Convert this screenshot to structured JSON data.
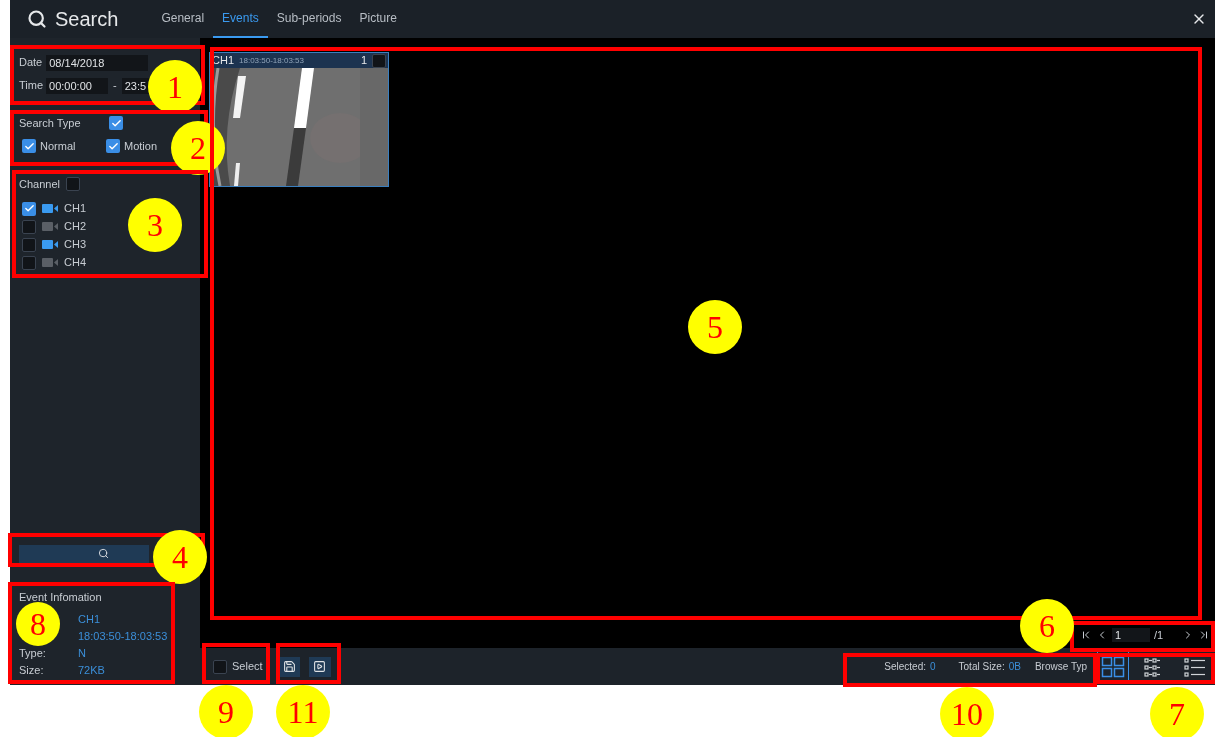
{
  "header": {
    "title": "Search",
    "tabs": [
      {
        "label": "General",
        "selected": false
      },
      {
        "label": "Events",
        "selected": true
      },
      {
        "label": "Sub-periods",
        "selected": false
      },
      {
        "label": "Picture",
        "selected": false
      }
    ]
  },
  "filters": {
    "date": {
      "label": "Date",
      "value": "08/14/2018"
    },
    "time": {
      "label": "Time",
      "start": "00:00:00",
      "separator": "-",
      "end": "23:5"
    },
    "search_type": {
      "label": "Search Type",
      "checked": true,
      "options": [
        {
          "label": "Normal",
          "checked": true
        },
        {
          "label": "Motion",
          "checked": true
        }
      ]
    },
    "channel": {
      "label": "Channel",
      "checked": false,
      "items": [
        {
          "label": "CH1",
          "checked": true,
          "online": true
        },
        {
          "label": "CH2",
          "checked": false,
          "online": false
        },
        {
          "label": "CH3",
          "checked": false,
          "online": true
        },
        {
          "label": "CH4",
          "checked": false,
          "online": false
        }
      ]
    }
  },
  "event_info": {
    "title": "Event Infomation",
    "rows": [
      {
        "value": "CH1"
      },
      {
        "value": "18:03:50-18:03:53"
      },
      {
        "label": "Type:",
        "value": "N"
      },
      {
        "label": "Size:",
        "value": "72KB"
      }
    ]
  },
  "results": [
    {
      "channel": "CH1",
      "period": "18:03:50-18:03:53",
      "index": "1",
      "checked": false
    }
  ],
  "pagination": {
    "page": "1",
    "total": "/1"
  },
  "bottom_bar": {
    "select": {
      "label": "Select",
      "checked": false
    },
    "selected": {
      "label": "Selected:",
      "value": "0"
    },
    "total_size": {
      "label": "Total Size:",
      "value": "0B"
    },
    "browse_type": {
      "label": "Browse Typ"
    },
    "views": [
      {
        "kind": "grid",
        "selected": true
      },
      {
        "kind": "thumbnails",
        "selected": false
      },
      {
        "kind": "list",
        "selected": false
      }
    ]
  },
  "callouts": [
    {
      "number": "1"
    },
    {
      "number": "2"
    },
    {
      "number": "3"
    },
    {
      "number": "5"
    },
    {
      "number": "4"
    },
    {
      "number": "8"
    },
    {
      "number": "6"
    },
    {
      "number": "9"
    },
    {
      "number": "11"
    },
    {
      "number": "10"
    },
    {
      "number": "7"
    }
  ]
}
